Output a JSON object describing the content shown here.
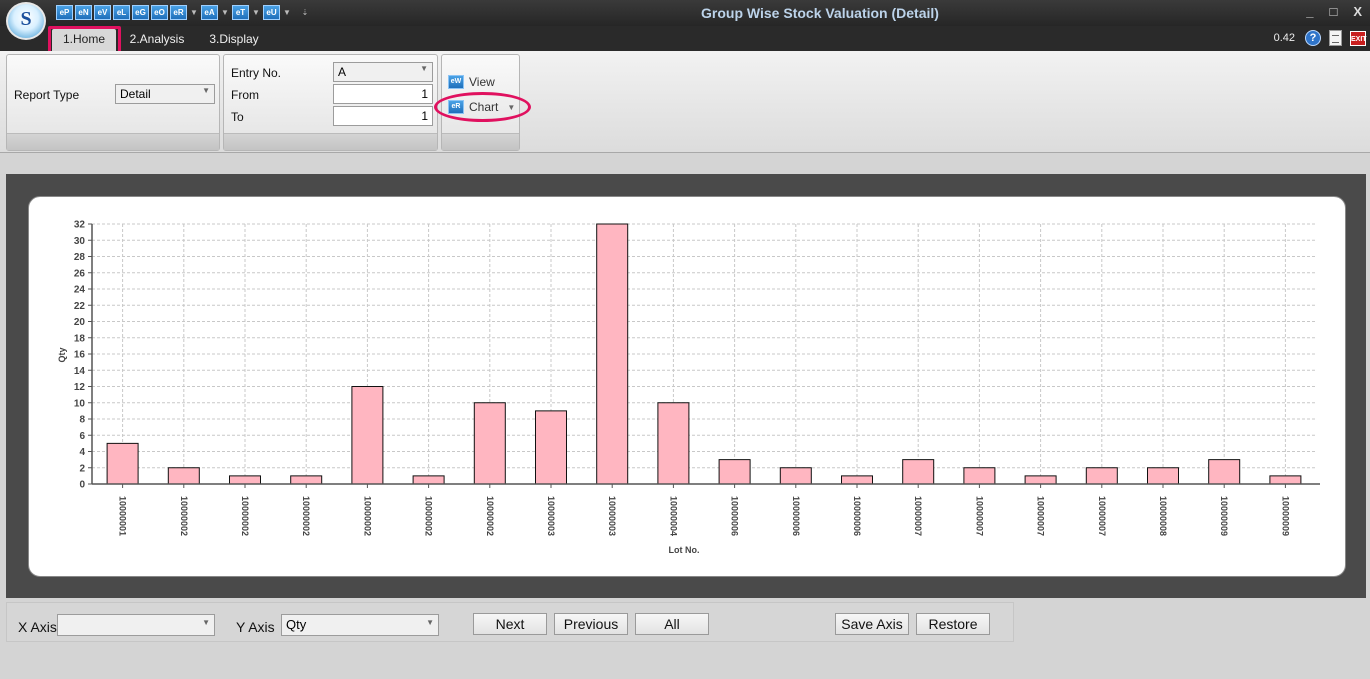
{
  "window": {
    "title": "Group Wise Stock Valuation (Detail)",
    "logo_letter": "S",
    "controls": [
      "_",
      "□",
      "X"
    ]
  },
  "quick_access": [
    {
      "label": "eP",
      "dropdown": false
    },
    {
      "label": "eN",
      "dropdown": false
    },
    {
      "label": "eV",
      "dropdown": false
    },
    {
      "label": "eL",
      "dropdown": false
    },
    {
      "label": "eG",
      "dropdown": false
    },
    {
      "label": "eO",
      "dropdown": false
    },
    {
      "label": "eR",
      "dropdown": true
    },
    {
      "label": "eA",
      "dropdown": true
    },
    {
      "label": "eT",
      "dropdown": true
    },
    {
      "label": "eU",
      "dropdown": true
    }
  ],
  "tabs": [
    {
      "label": "1.Home",
      "active": true
    },
    {
      "label": "2.Analysis",
      "active": false
    },
    {
      "label": "3.Display",
      "active": false
    }
  ],
  "status": {
    "zoom": "0.42",
    "help": "?",
    "exit": "EXIT"
  },
  "ribbon": {
    "report_type_label": "Report Type",
    "report_type_value": "Detail",
    "entry_no_label": "Entry No.",
    "entry_no_value": "A",
    "from_label": "From",
    "from_value": "1",
    "to_label": "To",
    "to_value": "1",
    "view_label": "View",
    "view_icon_text": "eW",
    "chart_label": "Chart",
    "chart_icon_text": "eR"
  },
  "chart_data": {
    "type": "bar",
    "xlabel": "Lot No.",
    "ylabel": "Qty",
    "ylim": [
      0,
      32
    ],
    "ytick_step": 2,
    "grid": true,
    "bar_color": "#ffb6c1",
    "categories": [
      "10000001",
      "10000002",
      "10000002",
      "10000002",
      "10000002",
      "10000002",
      "10000002",
      "10000003",
      "10000003",
      "10000004",
      "10000006",
      "10000006",
      "10000006",
      "10000007",
      "10000007",
      "10000007",
      "10000007",
      "10000008",
      "10000009",
      "10000009"
    ],
    "values": [
      5,
      2,
      1,
      1,
      12,
      1,
      10,
      9,
      32,
      10,
      3,
      2,
      1,
      3,
      2,
      1,
      2,
      2,
      3,
      1
    ]
  },
  "bottom": {
    "x_axis_label": "X Axis",
    "x_axis_value": "",
    "y_axis_label": "Y Axis",
    "y_axis_value": "Qty",
    "next": "Next",
    "previous": "Previous",
    "all": "All",
    "save_axis": "Save Axis",
    "restore": "Restore"
  }
}
